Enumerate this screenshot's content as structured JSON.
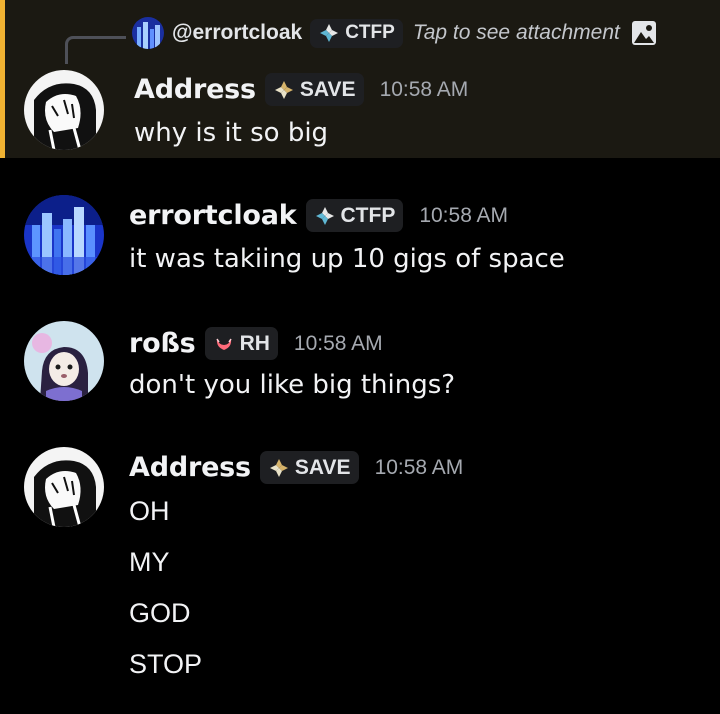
{
  "messages": [
    {
      "reply": {
        "username": "@errortcloak",
        "tag": "CTFP",
        "hint": "Tap to see attachment",
        "icon": "image-icon"
      },
      "username": "Address",
      "tag": "SAVE",
      "time": "10:58 AM",
      "lines": [
        "why is it so big"
      ],
      "highlighted": true,
      "highlight_color": "#f0b232"
    },
    {
      "username": "errortcloak",
      "tag": "CTFP",
      "time": "10:58 AM",
      "lines": [
        "it was takiing up 10 gigs of space"
      ]
    },
    {
      "username": "roßs",
      "tag": "RH",
      "time": "10:58 AM",
      "lines": [
        "don't you like big things?"
      ]
    },
    {
      "username": "Address",
      "tag": "SAVE",
      "time": "10:58 AM",
      "lines": [
        "OH",
        "MY",
        "GOD",
        "STOP"
      ]
    }
  ],
  "colors": {
    "background": "#000000",
    "highlight_bg": "#1b1912",
    "timestamp": "#a5a9b0",
    "text": "#f2f3f5"
  }
}
